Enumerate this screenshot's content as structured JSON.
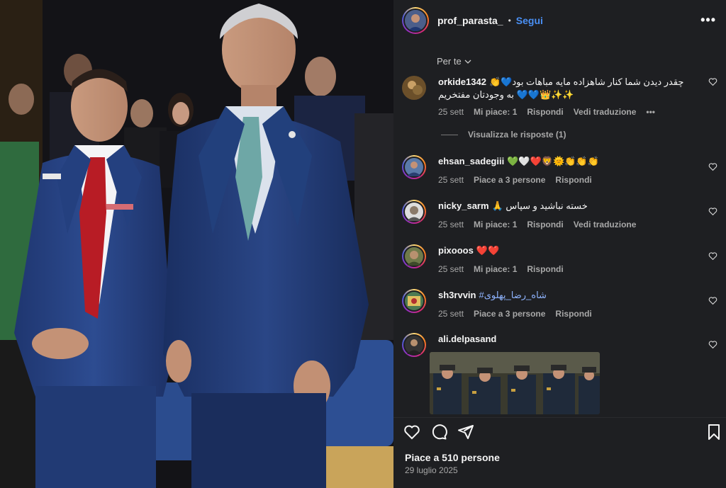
{
  "header": {
    "username": "prof_parasta_",
    "separator": "•",
    "follow_label": "Segui",
    "more_label": "•••"
  },
  "filter": {
    "label": "Per te"
  },
  "comments": [
    {
      "user": "orkide1342",
      "text": "👏💙چقدر دیدن شما کنار شاهزاده مایه مباهات بود به وجودتان مفتخریم 💙💙👑✨✨",
      "date": "25 sett",
      "likes": "Mi piace: 1",
      "reply": "Rispondi",
      "translate": "Vedi traduzione",
      "more": "•••"
    },
    {
      "user": "ehsan_sadegiii",
      "text": "💚🤍❤️🦁🌞👏👏👏",
      "date": "25 sett",
      "likes": "Piace a 3 persone",
      "reply": "Rispondi"
    },
    {
      "user": "nicky_sarm",
      "text": "🙏 خسته نباشید و سپاس",
      "date": "25 sett",
      "likes": "Mi piace: 1",
      "reply": "Rispondi",
      "translate": "Vedi traduzione"
    },
    {
      "user": "pixooos",
      "text": "❤️❤️",
      "date": "25 sett",
      "likes": "Mi piace: 1",
      "reply": "Rispondi"
    },
    {
      "user": "sh3rvvin",
      "text": "#شاه_رضا_پهلوی",
      "date": "25 sett",
      "likes": "Piace a 3 persone",
      "reply": "Rispondi"
    },
    {
      "user": "ali.delpasand",
      "text": ""
    }
  ],
  "view_replies": "Visualizza le risposte (1)",
  "footer": {
    "likes": "Piace a 510 persone",
    "date": "29 luglio 2025"
  },
  "colors": {
    "accent": "#4a90f5",
    "panel_bg": "#1e1f22",
    "muted_text": "#a8a8a8",
    "suit_blue": "#24407f",
    "tie_red": "#b81c25"
  },
  "icons": [
    "more-icon",
    "chevron-down-icon",
    "heart-icon",
    "comment-icon",
    "share-icon",
    "bookmark-icon"
  ]
}
